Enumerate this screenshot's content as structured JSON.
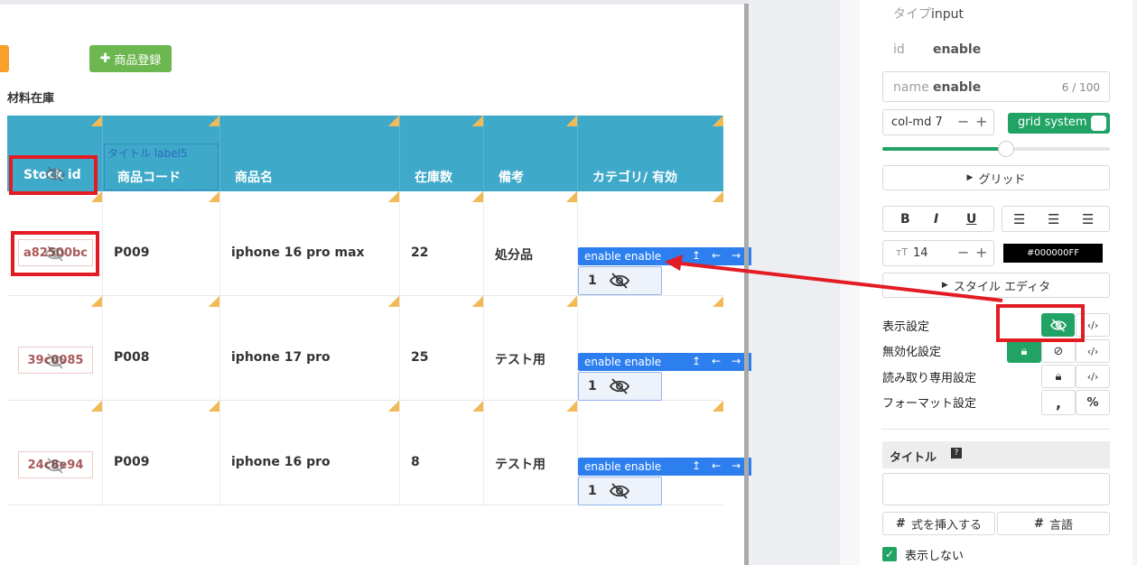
{
  "canvas": {
    "add_product_label": "商品登録",
    "section_title": "材料在庫",
    "selected_field_caption": "タイトル label5",
    "columns": [
      "Stock id",
      "商品コード",
      "商品名",
      "在庫数",
      "備考",
      "カテゴリ/ 有効"
    ],
    "rows": [
      {
        "stock_id": "a82500bc",
        "code": "P009",
        "name": "iphone 16 pro max",
        "qty": "22",
        "note": "処分品",
        "enable_label": "enable enable",
        "enable_value": "1"
      },
      {
        "stock_id": "39c0085",
        "code": "P008",
        "name": "iphone 17 pro",
        "qty": "25",
        "note": "テスト用",
        "enable_label": "enable enable",
        "enable_value": "1"
      },
      {
        "stock_id": "24c8e94",
        "code": "P009",
        "name": "iphone 16 pro",
        "qty": "8",
        "note": "テスト用",
        "enable_label": "enable enable",
        "enable_value": "1"
      }
    ]
  },
  "panel": {
    "type_label": "タイプ",
    "type_value": "input",
    "id_label": "id",
    "id_value": "enable",
    "name_label": "name",
    "name_value": "enable",
    "name_counter": "6 / 100",
    "col_value": "col-md 7",
    "grid_system_label": "grid system",
    "grid_button": "グリッド",
    "font_size": "14",
    "color_value": "#000000FF",
    "style_editor_button": "スタイル エディタ",
    "visibility_label": "表示設定",
    "disable_label": "無効化設定",
    "readonly_label": "読み取り専用設定",
    "format_label": "フォーマット設定",
    "title_header": "タイトル",
    "insert_formula_button": "式を挿入する",
    "language_button": "言語",
    "hide_checkbox_label": "表示しない"
  },
  "colors": {
    "header_bg": "#3fa9c9",
    "enable_bar": "#2d7ff0",
    "green": "#21a366",
    "highlight_red": "#e31b23"
  }
}
